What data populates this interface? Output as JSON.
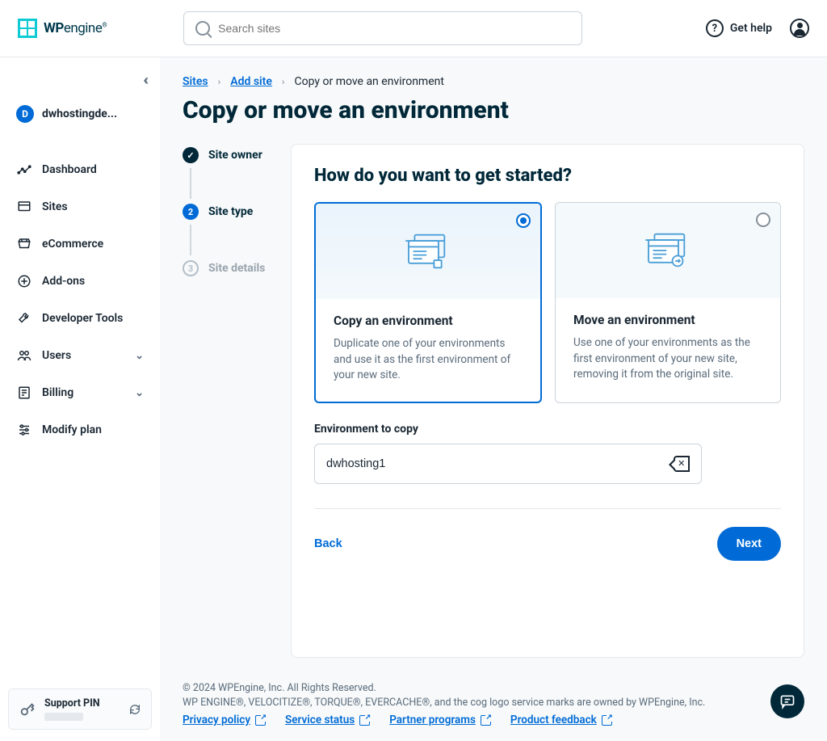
{
  "header": {
    "brand_prefix": "WP",
    "brand_suffix": "engine",
    "search_placeholder": "Search sites",
    "help_label": "Get help"
  },
  "sidebar": {
    "account_initial": "D",
    "account_name": "dwhostingde...",
    "items": [
      {
        "label": "Dashboard",
        "icon": "dashboard-icon",
        "expandable": false
      },
      {
        "label": "Sites",
        "icon": "sites-icon",
        "expandable": false
      },
      {
        "label": "eCommerce",
        "icon": "ecommerce-icon",
        "expandable": false
      },
      {
        "label": "Add-ons",
        "icon": "addons-icon",
        "expandable": false
      },
      {
        "label": "Developer Tools",
        "icon": "devtools-icon",
        "expandable": false
      },
      {
        "label": "Users",
        "icon": "users-icon",
        "expandable": true
      },
      {
        "label": "Billing",
        "icon": "billing-icon",
        "expandable": true
      },
      {
        "label": "Modify plan",
        "icon": "modify-icon",
        "expandable": false
      }
    ],
    "support_pin_label": "Support PIN"
  },
  "breadcrumb": {
    "sites": "Sites",
    "add_site": "Add site",
    "current": "Copy or move an environment"
  },
  "page_title": "Copy or move an environment",
  "stepper": [
    {
      "label": "Site owner",
      "state": "done",
      "mark": "✓"
    },
    {
      "label": "Site type",
      "state": "active",
      "mark": "2"
    },
    {
      "label": "Site details",
      "state": "future",
      "mark": "3"
    }
  ],
  "card": {
    "heading": "How do you want to get started?",
    "options": [
      {
        "title": "Copy an environment",
        "desc": "Duplicate one of your environments and use it as the first environment of your new site.",
        "selected": true
      },
      {
        "title": "Move an environment",
        "desc": "Use one of your environments as the first environment of your new site, removing it from the original site.",
        "selected": false
      }
    ],
    "field_label": "Environment to copy",
    "field_value": "dwhosting1",
    "back_label": "Back",
    "next_label": "Next"
  },
  "footer": {
    "line1": "© 2024 WPEngine, Inc. All Rights Reserved.",
    "line2": "WP ENGINE®, VELOCITIZE®, TORQUE®, EVERCACHE®, and the cog logo service marks are owned by WPEngine, Inc.",
    "links": [
      {
        "label": "Privacy policy"
      },
      {
        "label": "Service status"
      },
      {
        "label": "Partner programs"
      },
      {
        "label": "Product feedback"
      }
    ]
  }
}
